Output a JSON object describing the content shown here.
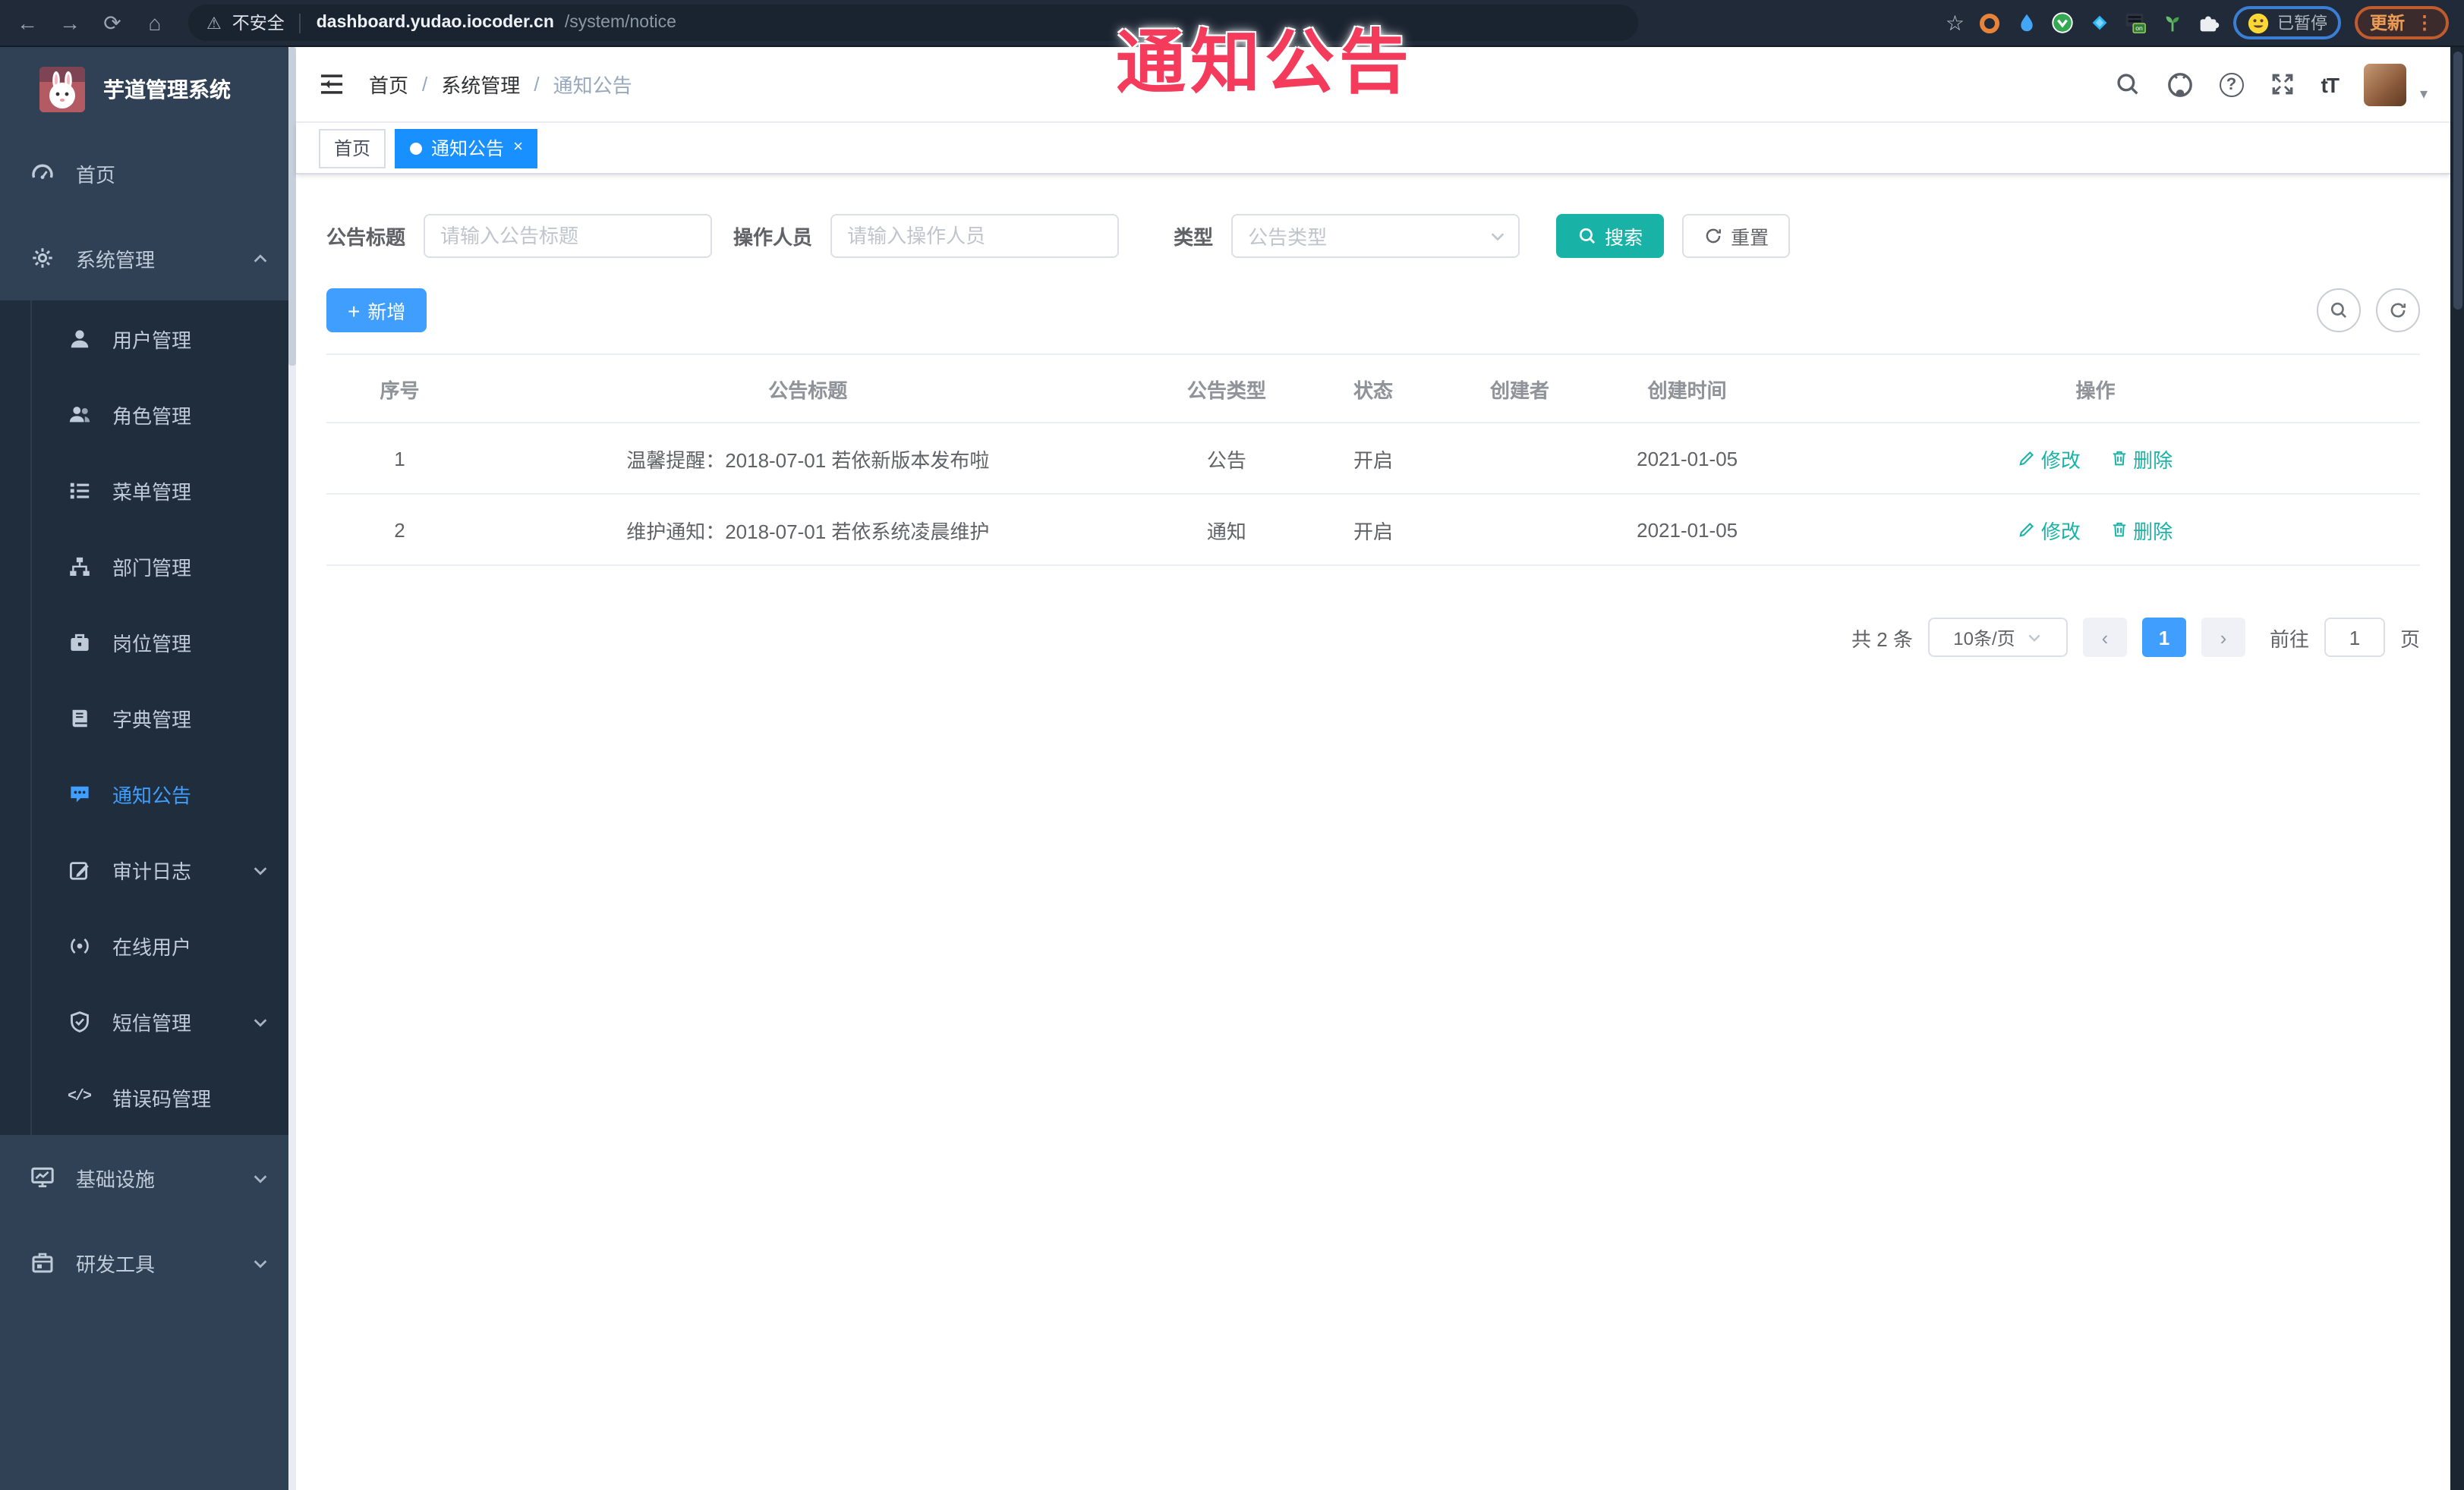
{
  "browser": {
    "security_label": "不安全",
    "url_host": "dashboard.yudao.iocoder.cn",
    "url_path": "/system/notice",
    "paused_label": "已暂停",
    "update_label": "更新"
  },
  "overlay": {
    "title": "通知公告"
  },
  "icons": {
    "back_glyph": "←",
    "forward_glyph": "→",
    "reload_glyph": "⟳",
    "home_glyph": "⌂",
    "warning_glyph": "⚠",
    "star_glyph": "☆",
    "overflow_glyph": "⋮",
    "menu_overflow_glyph": "⋮",
    "caret_glyph": "▾",
    "question_glyph": "?",
    "font_size_glyph": "tT",
    "plus_glyph": "+",
    "code_glyph": "</>",
    "close_glyph": "×",
    "prev_glyph": "‹",
    "next_glyph": "›",
    "on_badge": "on"
  },
  "sidebar": {
    "app_title": "芋道管理系统",
    "home_label": "首页",
    "system_label": "系统管理",
    "submenu": [
      {
        "label": "用户管理",
        "icon": "user-icon"
      },
      {
        "label": "角色管理",
        "icon": "role-icon"
      },
      {
        "label": "菜单管理",
        "icon": "menu-list-icon"
      },
      {
        "label": "部门管理",
        "icon": "department-icon"
      },
      {
        "label": "岗位管理",
        "icon": "post-icon"
      },
      {
        "label": "字典管理",
        "icon": "dictionary-icon"
      },
      {
        "label": "通知公告",
        "icon": "announcement-icon",
        "active": true
      },
      {
        "label": "审计日志",
        "icon": "audit-log-icon",
        "expandable": true
      },
      {
        "label": "在线用户",
        "icon": "online-user-icon"
      },
      {
        "label": "短信管理",
        "icon": "sms-shield-icon",
        "expandable": true
      },
      {
        "label": "错误码管理",
        "icon": "error-code-icon"
      }
    ],
    "infra_label": "基础设施",
    "devtools_label": "研发工具"
  },
  "navbar": {
    "breadcrumb": [
      "首页",
      "系统管理",
      "通知公告"
    ]
  },
  "tags": {
    "home_label": "首页",
    "active_label": "通知公告"
  },
  "filters": {
    "title_label": "公告标题",
    "title_placeholder": "请输入公告标题",
    "operator_label": "操作人员",
    "operator_placeholder": "请输入操作人员",
    "type_label": "类型",
    "type_placeholder": "公告类型",
    "search_label": "搜索",
    "reset_label": "重置"
  },
  "toolbar": {
    "add_label": "新增"
  },
  "table": {
    "headers": [
      "序号",
      "公告标题",
      "公告类型",
      "状态",
      "创建者",
      "创建时间",
      "操作"
    ],
    "edit_label": "修改",
    "delete_label": "删除",
    "rows": [
      {
        "no": "1",
        "title": "温馨提醒：2018-07-01 若依新版本发布啦",
        "type": "公告",
        "status": "开启",
        "creator": "",
        "created": "2021-01-05"
      },
      {
        "no": "2",
        "title": "维护通知：2018-07-01 若依系统凌晨维护",
        "type": "通知",
        "status": "开启",
        "creator": "",
        "created": "2021-01-05"
      }
    ]
  },
  "pagination": {
    "total_label": "共 2 条",
    "page_size_label": "10条/页",
    "current_page": "1",
    "goto_label": "前往",
    "goto_value": "1",
    "unit_label": "页"
  },
  "colors": {
    "primary": "#409eff",
    "tag_active": "#1890ff",
    "action_teal": "#18b3a6",
    "overlay_red": "#f43b5c",
    "sidebar_bg": "#304156",
    "submenu_bg": "#1f2d3d"
  }
}
